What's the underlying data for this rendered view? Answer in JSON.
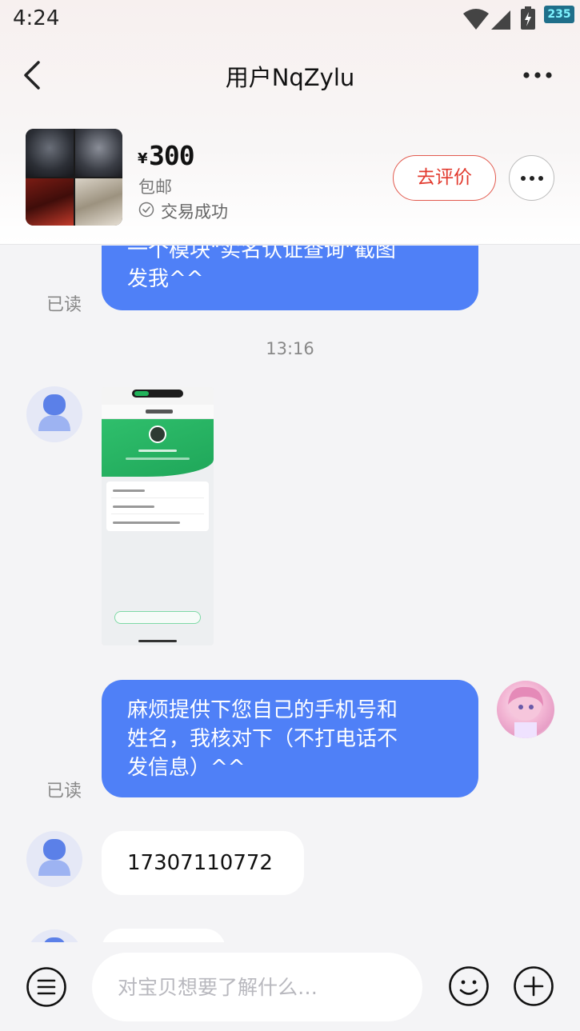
{
  "status_bar": {
    "time": "4:24",
    "battery_badge": "235",
    "icons": [
      "wifi-icon",
      "signal-icon",
      "battery-charging-icon"
    ]
  },
  "header": {
    "title": "用户NqZylu",
    "back_icon": "chevron-left-icon",
    "more_icon": "more-dots-icon"
  },
  "product_card": {
    "currency_symbol": "¥",
    "price": "300",
    "shipping": "包邮",
    "deal_status": "交易成功",
    "review_button_label": "去评价",
    "accent_color": "#e23a2e"
  },
  "messages": [
    {
      "type": "text",
      "direction": "out",
      "lines": [
        "一个模块\"实名认证查询\"截图",
        "发我^^"
      ],
      "read_label": "已读"
    },
    {
      "type": "timestamp",
      "text": "13:16"
    },
    {
      "type": "image",
      "direction": "in",
      "description": "screenshot"
    },
    {
      "type": "text",
      "direction": "out",
      "lines": [
        "麻烦提供下您自己的手机号和",
        "姓名，我核对下（不打电话不",
        "发信息）^^"
      ],
      "read_label": "已读"
    },
    {
      "type": "text",
      "direction": "in",
      "text": "17307110772"
    }
  ],
  "input_bar": {
    "placeholder": "对宝贝想要了解什么…",
    "menu_icon": "menu-lines-icon",
    "emoji_icon": "smiley-icon",
    "plus_icon": "plus-circle-icon"
  },
  "colors": {
    "outgoing_bubble": "#4f80f7",
    "incoming_bubble": "#ffffff",
    "background": "#f4f4f6"
  }
}
